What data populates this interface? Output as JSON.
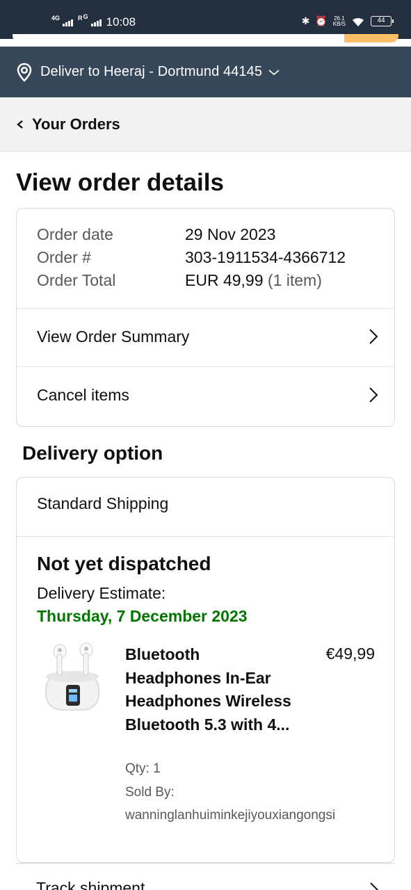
{
  "status_bar": {
    "network_1": "4G",
    "network_2": "R",
    "network_2_sup": "G",
    "time": "10:08",
    "speed": "26.1",
    "speed_unit": "KB/S",
    "battery": "44"
  },
  "deliver": {
    "text": "Deliver to Heeraj - Dortmund 44145"
  },
  "nav": {
    "title": "Your Orders"
  },
  "page": {
    "title": "View order details"
  },
  "order": {
    "date_label": "Order date",
    "date_value": "29 Nov 2023",
    "number_label": "Order #",
    "number_value": "303-1911534-4366712",
    "total_label": "Order Total",
    "total_value": "EUR 49,99",
    "total_items": "(1 item)",
    "summary_link": "View Order Summary",
    "cancel_link": "Cancel items"
  },
  "delivery": {
    "section_title": "Delivery option",
    "shipping_method": "Standard Shipping",
    "status": "Not yet dispatched",
    "estimate_label": "Delivery Estimate:",
    "estimate_date": "Thursday, 7 December 2023",
    "estimate_color": "#007600"
  },
  "product": {
    "title": "Bluetooth Headphones In-Ear Headphones Wireless Bluetooth 5.3 with 4...",
    "price": "€49,99",
    "qty": "Qty: 1",
    "sold_by_label": "Sold By:",
    "sold_by_value": "wanninglanhuiminkejiyouxiangongsi",
    "image_icon": "earbuds-case-icon"
  },
  "track": {
    "label": "Track shipment"
  },
  "colors": {
    "header_dark": "#232f3e",
    "header_mid": "#37475a",
    "search_button": "#febd69"
  }
}
